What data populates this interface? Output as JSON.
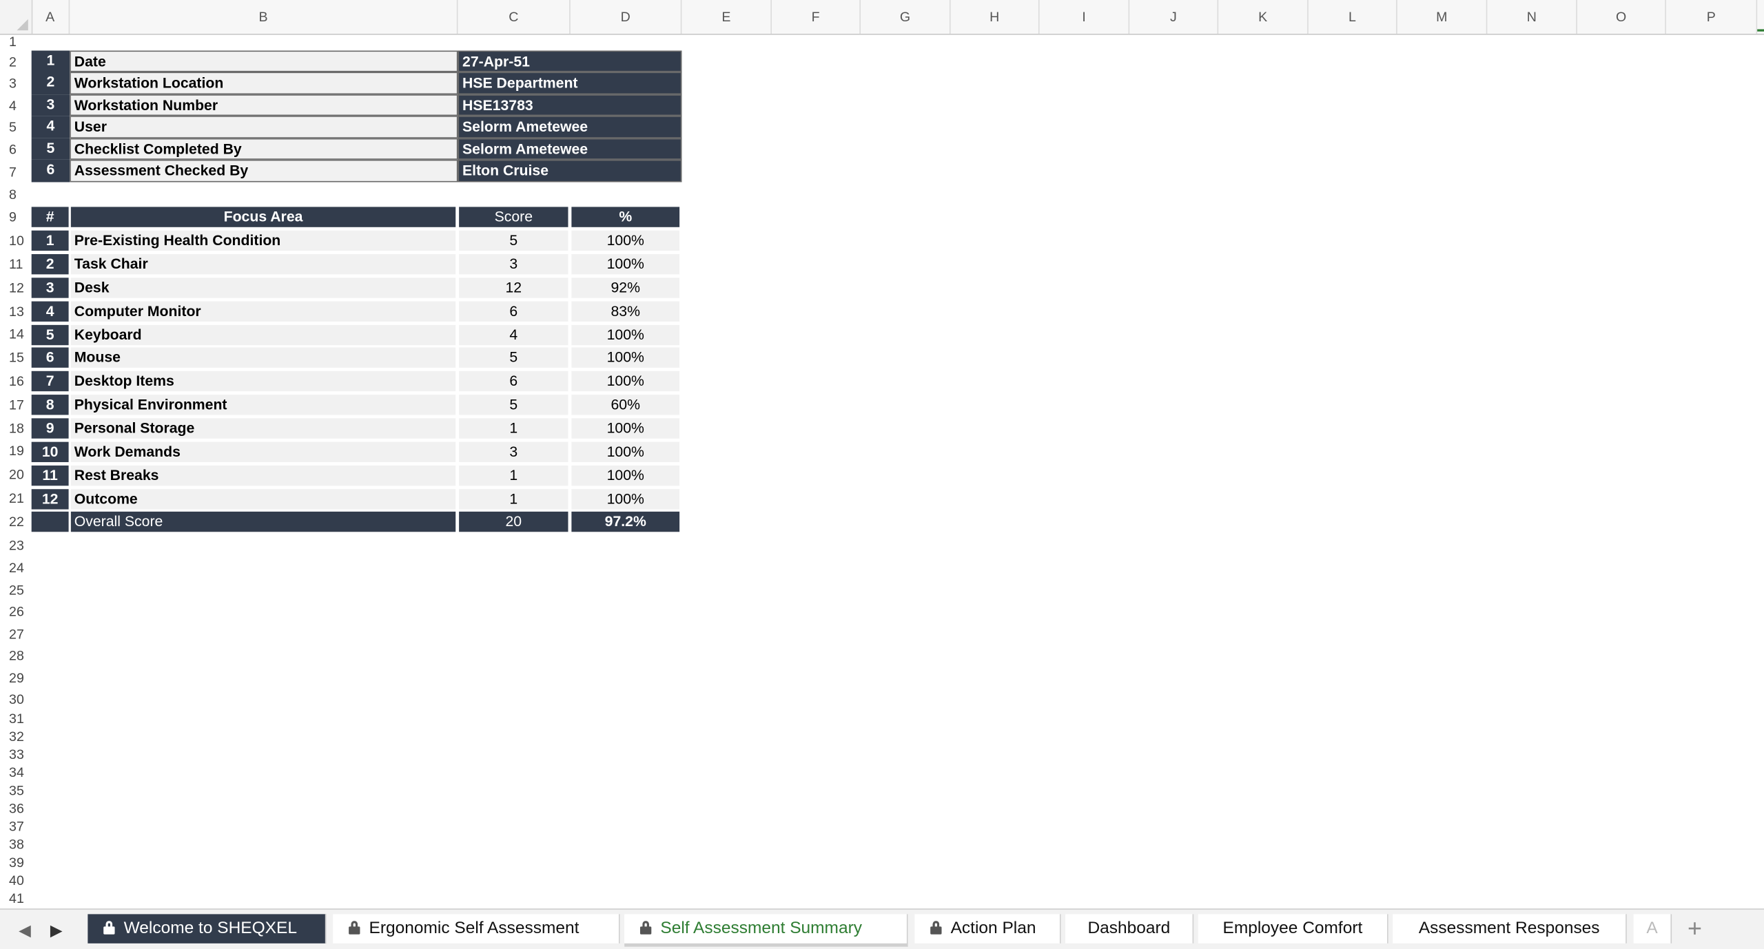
{
  "columns": [
    "A",
    "B",
    "C",
    "D",
    "E",
    "F",
    "G",
    "H",
    "I",
    "J",
    "K",
    "L",
    "M",
    "N",
    "O",
    "P"
  ],
  "rows": [
    "1",
    "2",
    "3",
    "4",
    "5",
    "6",
    "7",
    "8",
    "9",
    "10",
    "11",
    "12",
    "13",
    "14",
    "15",
    "16",
    "17",
    "18",
    "19",
    "20",
    "21",
    "22",
    "23",
    "24",
    "25",
    "26",
    "27",
    "28",
    "29",
    "30",
    "31",
    "32",
    "33",
    "34",
    "35",
    "36",
    "37",
    "38",
    "39",
    "40",
    "41"
  ],
  "info": [
    {
      "n": "1",
      "label": "Date",
      "value": "27-Apr-51"
    },
    {
      "n": "2",
      "label": "Workstation Location",
      "value": "HSE Department"
    },
    {
      "n": "3",
      "label": "Workstation Number",
      "value": "HSE13783"
    },
    {
      "n": "4",
      "label": "User",
      "value": "Selorm Ametewee"
    },
    {
      "n": "5",
      "label": "Checklist Completed By",
      "value": "Selorm Ametewee"
    },
    {
      "n": "6",
      "label": "Assessment Checked By",
      "value": "Elton Cruise"
    }
  ],
  "summary": {
    "headers": {
      "num": "#",
      "area": "Focus Area",
      "score": "Score",
      "pct": "%"
    },
    "rows": [
      {
        "n": "1",
        "area": "Pre-Existing Health Condition",
        "score": "5",
        "pct": "100%"
      },
      {
        "n": "2",
        "area": "Task Chair",
        "score": "3",
        "pct": "100%"
      },
      {
        "n": "3",
        "area": "Desk",
        "score": "12",
        "pct": "92%"
      },
      {
        "n": "4",
        "area": "Computer Monitor",
        "score": "6",
        "pct": "83%"
      },
      {
        "n": "5",
        "area": "Keyboard",
        "score": "4",
        "pct": "100%"
      },
      {
        "n": "6",
        "area": "Mouse",
        "score": "5",
        "pct": "100%"
      },
      {
        "n": "7",
        "area": "Desktop Items",
        "score": "6",
        "pct": "100%"
      },
      {
        "n": "8",
        "area": "Physical Environment",
        "score": "5",
        "pct": "60%"
      },
      {
        "n": "9",
        "area": "Personal Storage",
        "score": "1",
        "pct": "100%"
      },
      {
        "n": "10",
        "area": "Work Demands",
        "score": "3",
        "pct": "100%"
      },
      {
        "n": "11",
        "area": "Rest Breaks",
        "score": "1",
        "pct": "100%"
      },
      {
        "n": "12",
        "area": "Outcome",
        "score": "1",
        "pct": "100%"
      }
    ],
    "overall": {
      "label": "Overall Score",
      "score": "20",
      "pct": "97.2%"
    }
  },
  "tabs": [
    {
      "label": "Welcome to SHEQXEL",
      "locked": true,
      "style": "dark"
    },
    {
      "label": "Ergonomic Self Assessment",
      "locked": true,
      "style": "normal"
    },
    {
      "label": "Self Assessment Summary",
      "locked": true,
      "style": "active"
    },
    {
      "label": "Action Plan",
      "locked": true,
      "style": "normal"
    },
    {
      "label": "Dashboard",
      "locked": false,
      "style": "normal"
    },
    {
      "label": "Employee Comfort",
      "locked": false,
      "style": "normal"
    },
    {
      "label": "Assessment Responses",
      "locked": false,
      "style": "normal"
    }
  ],
  "tab_overflow_letter": "A",
  "icons": {
    "prev": "chevron-left-icon",
    "next": "chevron-right-icon",
    "add": "plus-icon",
    "lock": "lock-icon"
  },
  "colors": {
    "header_dark": "#323c4c",
    "active_tab": "#2e7d32",
    "cell_light": "#f1f1f1"
  }
}
